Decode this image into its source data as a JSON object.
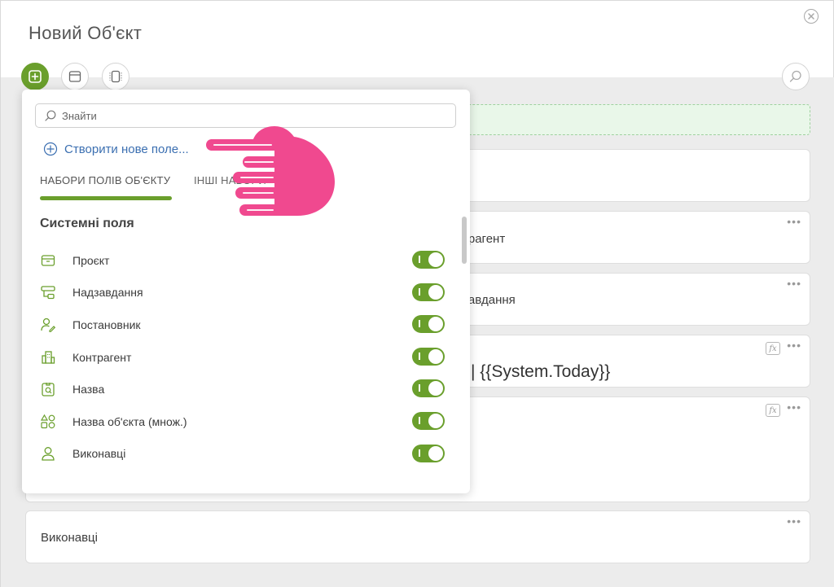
{
  "window": {
    "title": "Новий Об'єкт"
  },
  "toolbar": {
    "buttons": [
      {
        "name": "add-field-button",
        "icon": "plus-square-icon",
        "active": true
      },
      {
        "name": "layout-button",
        "icon": "layout-icon",
        "active": false
      },
      {
        "name": "panel-button",
        "icon": "sidebar-icon",
        "active": false
      }
    ],
    "search_icon": "search-icon"
  },
  "form": {
    "cards": [
      {
        "id": "card-1",
        "text": "",
        "has_fx": false,
        "has_more": false
      },
      {
        "id": "card-2",
        "text": "Контрагент",
        "visible_text": "трагент",
        "has_fx": false,
        "has_more": true
      },
      {
        "id": "card-3",
        "text": "Надзавдання",
        "visible_text": "завдання",
        "has_fx": false,
        "has_more": true
      },
      {
        "id": "card-4",
        "text": "| {{System.Today}}",
        "has_fx": true,
        "has_more": true
      },
      {
        "id": "card-5",
        "text": "",
        "has_fx": true,
        "has_more": true
      },
      {
        "id": "card-6",
        "text": "Виконавці",
        "has_fx": false,
        "has_more": true
      }
    ],
    "more_label": "•••",
    "fx_label": "fx"
  },
  "panel": {
    "search_placeholder": "Знайти",
    "create_label": "Створити нове поле...",
    "tabs": [
      {
        "label": "НАБОРИ ПОЛІВ ОБ'ЄКТУ",
        "active": true
      },
      {
        "label": "ІНШІ НАБОРИ",
        "active": false
      }
    ],
    "section_title": "Системні поля",
    "fields": [
      {
        "label": "Проєкт",
        "icon": "project-box-icon",
        "enabled": true
      },
      {
        "label": "Надзавдання",
        "icon": "parent-task-icon",
        "enabled": true
      },
      {
        "label": "Постановник",
        "icon": "user-edit-icon",
        "enabled": true
      },
      {
        "label": "Контрагент",
        "icon": "building-icon",
        "enabled": true
      },
      {
        "label": "Назва",
        "icon": "name-tag-icon",
        "enabled": true
      },
      {
        "label": "Назва об'єкта (множ.)",
        "icon": "shapes-icon",
        "enabled": true
      },
      {
        "label": "Виконавці",
        "icon": "person-icon",
        "enabled": true
      }
    ]
  },
  "colors": {
    "accent_green": "#6a9f2c",
    "link_blue": "#3b6fb1",
    "pointer_pink": "#f0498f",
    "drop_zone_bg": "#e9f7e9"
  }
}
